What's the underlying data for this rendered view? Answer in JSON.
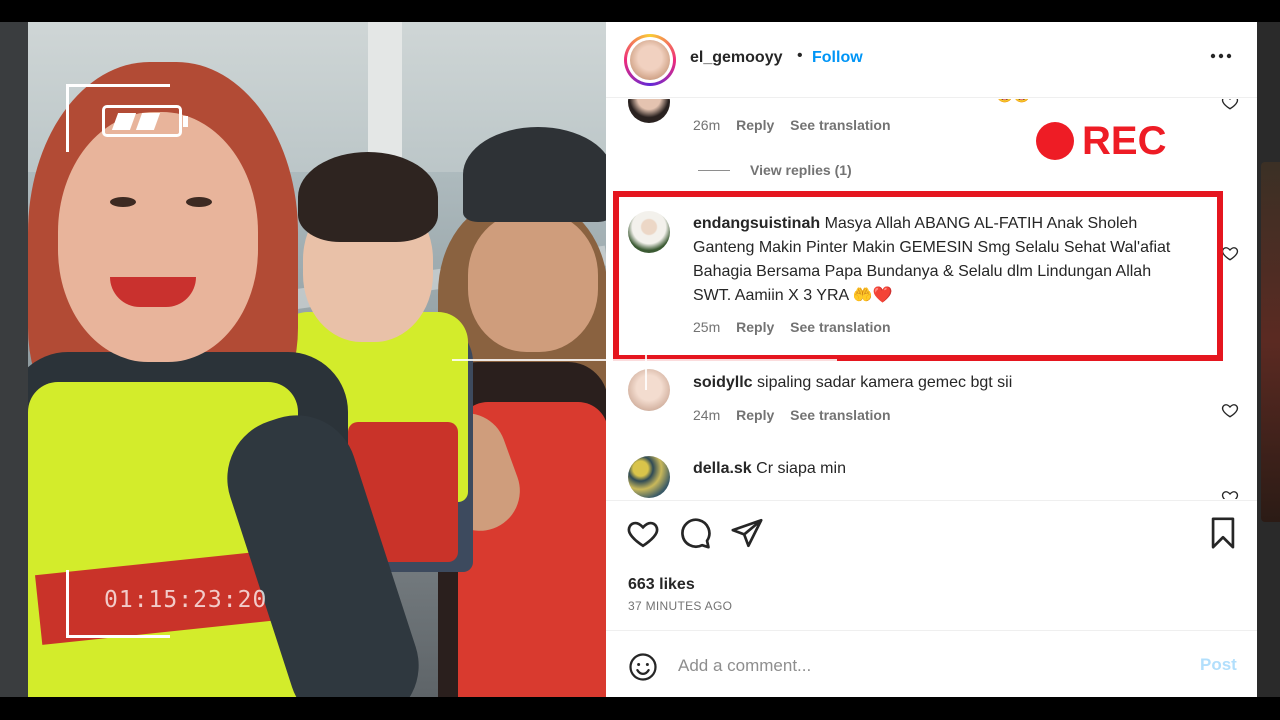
{
  "photo": {
    "timecode": "01:15:23:20"
  },
  "post": {
    "username": "el_gemooyy",
    "separator": "•",
    "follow_label": "Follow",
    "more_icon": "more-horizontal-icon"
  },
  "overlay": {
    "rec_label": "REC",
    "rec_color": "#ee1c25",
    "highlight_color": "#e5161f"
  },
  "comments": [
    {
      "username": "",
      "text": "",
      "time": "26m",
      "reply_label": "Reply",
      "translate_label": "See translation"
    },
    {
      "view_replies_label": "View replies (1)"
    },
    {
      "username": "endangsuistinah",
      "text": "Masya Allah ABANG AL-FATIH Anak Sholeh Ganteng Makin Pinter Makin GEMESIN Smg Selalu Sehat Wal'afiat Bahagia Bersama Papa Bundanya & Selalu dlm Lindungan Allah SWT. Aamiin X 3 YRA 🤲❤️",
      "time": "25m",
      "reply_label": "Reply",
      "translate_label": "See translation"
    },
    {
      "username": "soidyllc",
      "text": "sipaling sadar kamera gemec bgt sii",
      "time": "24m",
      "reply_label": "Reply",
      "translate_label": "See translation"
    },
    {
      "username": "della.sk",
      "text": "Cr siapa min"
    }
  ],
  "actions": {
    "likes": "663 likes",
    "time_ago": "37 MINUTES AGO"
  },
  "add_comment": {
    "placeholder": "Add a comment...",
    "post_label": "Post",
    "accent_color": "#0095f6"
  }
}
